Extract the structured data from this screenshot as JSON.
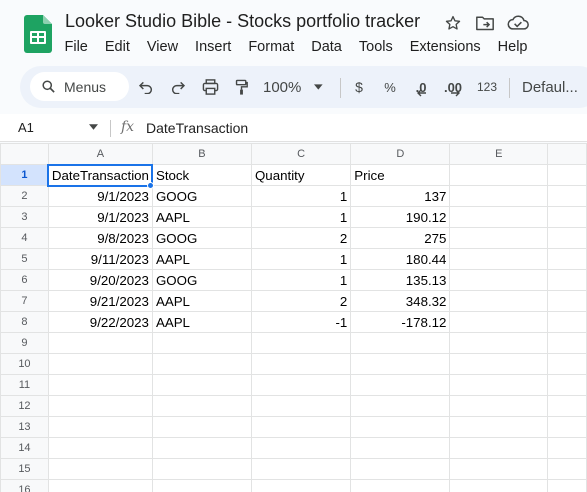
{
  "app": {
    "title": "Looker Studio Bible - Stocks portfolio tracker",
    "menu": [
      "File",
      "Edit",
      "View",
      "Insert",
      "Format",
      "Data",
      "Tools",
      "Extensions",
      "Help"
    ],
    "title_icons": [
      "star-icon",
      "move-to-folder-icon",
      "cloud-saved-icon"
    ]
  },
  "toolbar": {
    "menus_label": "Menus",
    "zoom": "100%",
    "currency_label": "$",
    "percent_label": "%",
    "decrease_decimal_label": ".0",
    "increase_decimal_label": ".00",
    "more_formats_label": "123",
    "font_label": "Defaul..."
  },
  "formula_bar": {
    "cell_ref": "A1",
    "fx_label": "fx",
    "value": "DateTransaction"
  },
  "sheet": {
    "columns": [
      "A",
      "B",
      "C",
      "D",
      "E"
    ],
    "row_numbers": [
      "1",
      "2",
      "3",
      "4",
      "5",
      "6",
      "7",
      "8",
      "9",
      "10",
      "11",
      "12",
      "13",
      "14",
      "15",
      "16"
    ],
    "rows": [
      [
        "DateTransaction",
        "Stock",
        "Quantity",
        "Price",
        ""
      ],
      [
        "9/1/2023",
        "GOOG",
        "1",
        "137",
        ""
      ],
      [
        "9/1/2023",
        "AAPL",
        "1",
        "190.12",
        ""
      ],
      [
        "9/8/2023",
        "GOOG",
        "2",
        "275",
        ""
      ],
      [
        "9/11/2023",
        "AAPL",
        "1",
        "180.44",
        ""
      ],
      [
        "9/20/2023",
        "GOOG",
        "1",
        "135.13",
        ""
      ],
      [
        "9/21/2023",
        "AAPL",
        "2",
        "348.32",
        ""
      ],
      [
        "9/22/2023",
        "AAPL",
        "-1",
        "-178.12",
        ""
      ],
      [
        "",
        "",
        "",
        "",
        ""
      ],
      [
        "",
        "",
        "",
        "",
        ""
      ],
      [
        "",
        "",
        "",
        "",
        ""
      ],
      [
        "",
        "",
        "",
        "",
        ""
      ],
      [
        "",
        "",
        "",
        "",
        ""
      ],
      [
        "",
        "",
        "",
        "",
        ""
      ],
      [
        "",
        "",
        "",
        "",
        ""
      ],
      [
        "",
        "",
        "",
        "",
        ""
      ]
    ]
  },
  "colors": {
    "accent": "#1a73e8",
    "sheets_green": "#188038",
    "header_selected": "#d3e3fd"
  }
}
